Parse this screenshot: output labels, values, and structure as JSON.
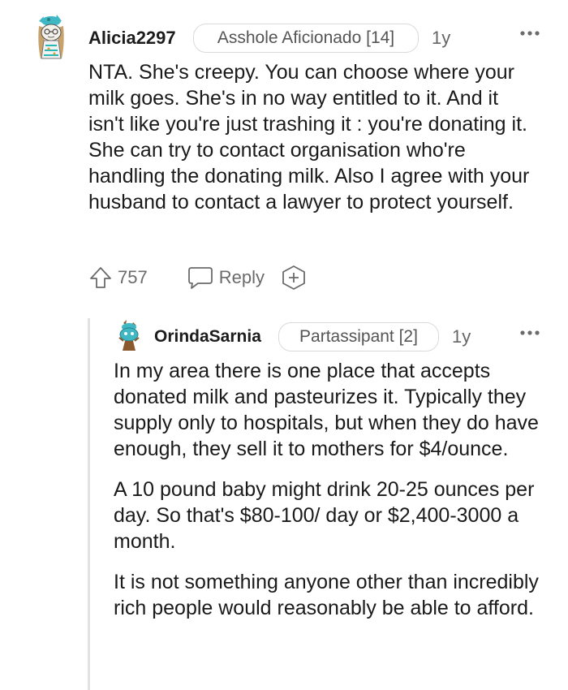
{
  "comments": [
    {
      "username": "Alicia2297",
      "flair": "Asshole Aficionado [14]",
      "age": "1y",
      "avatar_icon": "snoo-avatar-icon",
      "paragraphs": [
        "NTA. She's creepy. You can choose where your milk goes. She's in no way entitled to it. And it isn't like you're just trashing it : you're donating it. She can try to contact organisation who're handling the donating milk. Also I agree with your husband to contact a lawyer to protect yourself."
      ],
      "votes": "757",
      "reply_label": "Reply"
    },
    {
      "username": "OrindaSarnia",
      "flair": "Partassipant [2]",
      "age": "1y",
      "avatar_icon": "snoo-avatar-icon",
      "paragraphs": [
        "In my area there is one place that accepts donated milk and pasteurizes it. Typically they supply only to hospitals, but when they do have enough, they sell it to mothers for $4/ounce.",
        "A 10 pound baby might drink 20-25 ounces per day. So that's $80-100/ day or $2,400-3000 a month.",
        "It is not something anyone other than incredibly rich people would reasonably be able to afford."
      ]
    }
  ],
  "more_icon": "more-options-icon",
  "colors": {
    "text": "#1a1a1b",
    "muted": "#6b6b6b",
    "flair_border": "#dadada",
    "thread_line": "#e2e2e2"
  }
}
